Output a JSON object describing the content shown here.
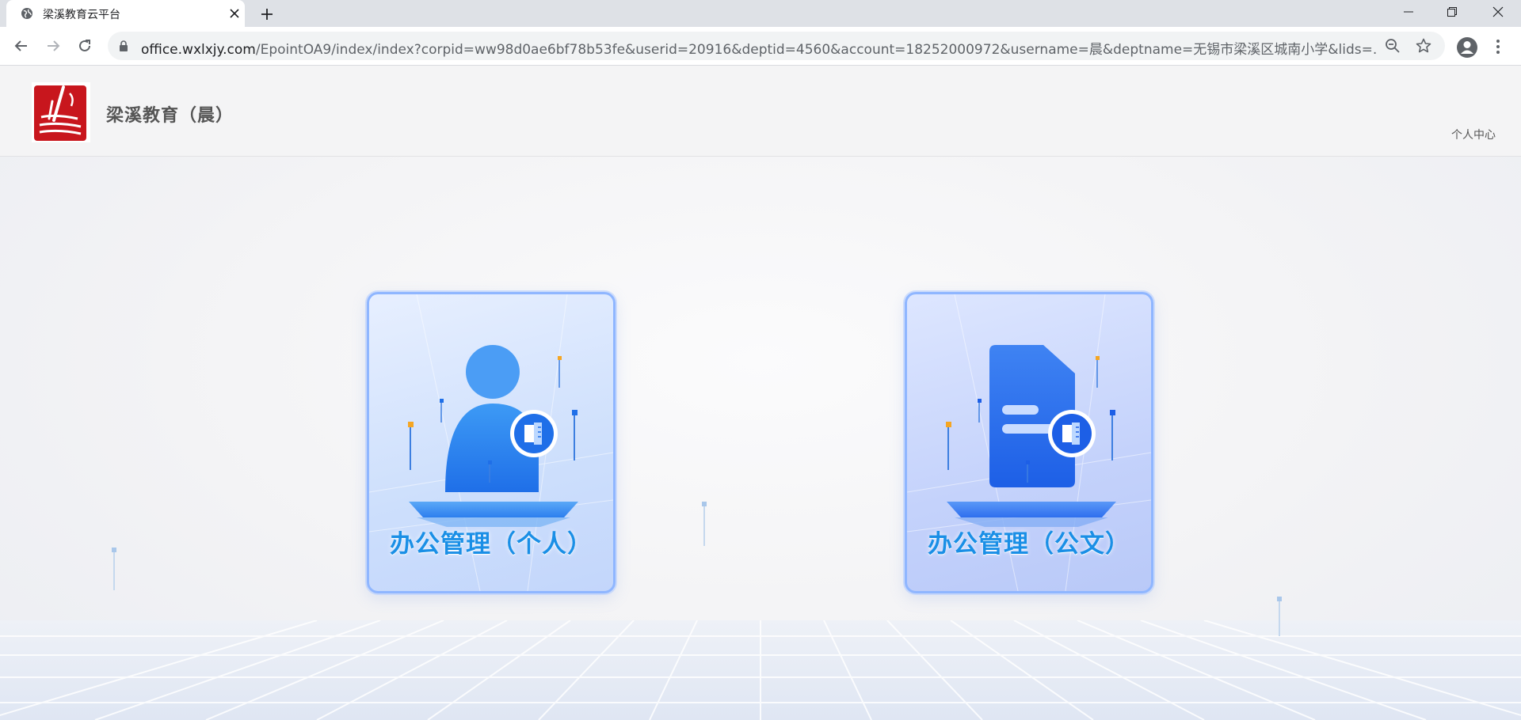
{
  "browser": {
    "tab_title": "梁溪教育云平台",
    "url_host": "office.wxlxjy.com",
    "url_path": "/EpointOA9/index/index?corpid=ww98d0ae6bf78b53fe&userid=20916&deptid=4560&account=18252000972&username=晨&deptname=无锡市梁溪区城南小学&lids=..."
  },
  "header": {
    "site_title": "梁溪教育（晨）",
    "user_center_label": "个人中心"
  },
  "cards": [
    {
      "label": "办公管理（个人）",
      "icon": "personal-office-icon"
    },
    {
      "label": "办公管理（公文）",
      "icon": "document-office-icon"
    }
  ],
  "colors": {
    "accent": "#1a8fe6",
    "logo_red": "#c8161d",
    "card_border": "#8fb6ff"
  }
}
